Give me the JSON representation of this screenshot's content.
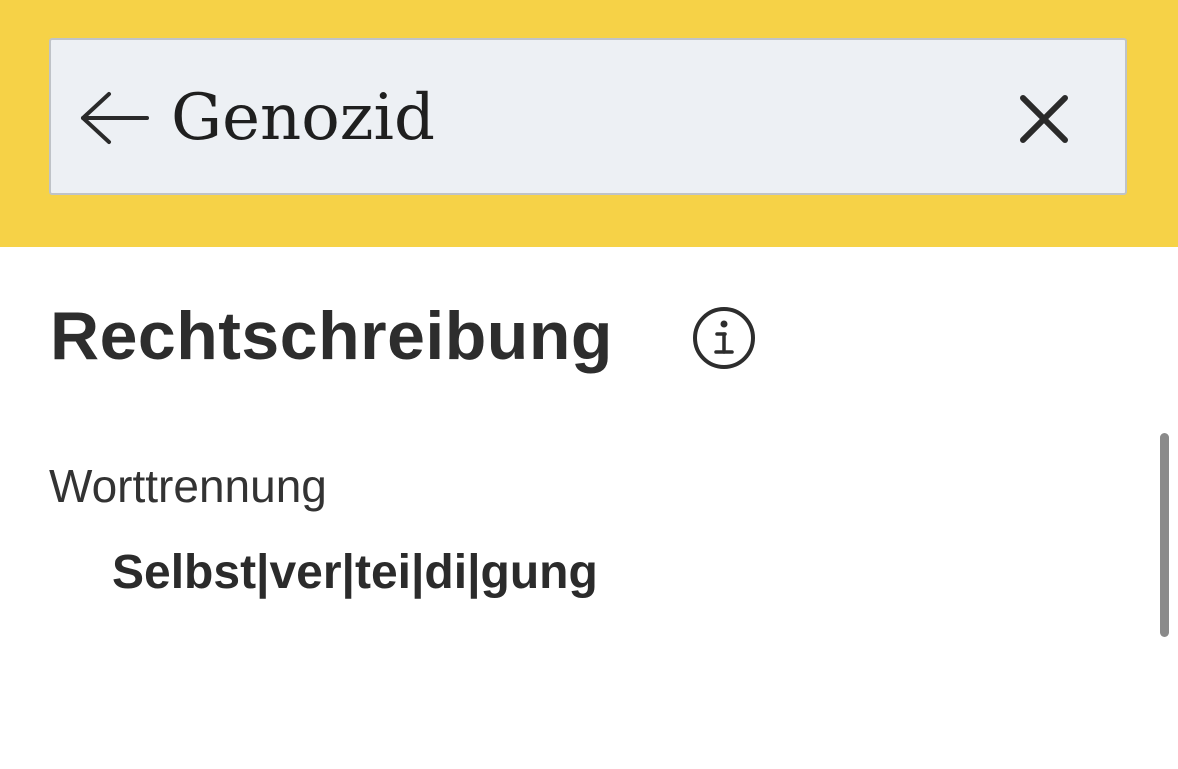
{
  "search": {
    "value": "Genozid",
    "back_icon": "arrow-left-icon",
    "clear_icon": "close-icon"
  },
  "section": {
    "title": "Rechtschreibung",
    "info_icon": "info-icon"
  },
  "hyphenation": {
    "label": "Worttrennung",
    "value": "Selbst|ver|tei|di|gung"
  },
  "colors": {
    "header_background": "#f6d247",
    "search_background": "#edf0f4",
    "text": "#2d2d2d"
  }
}
